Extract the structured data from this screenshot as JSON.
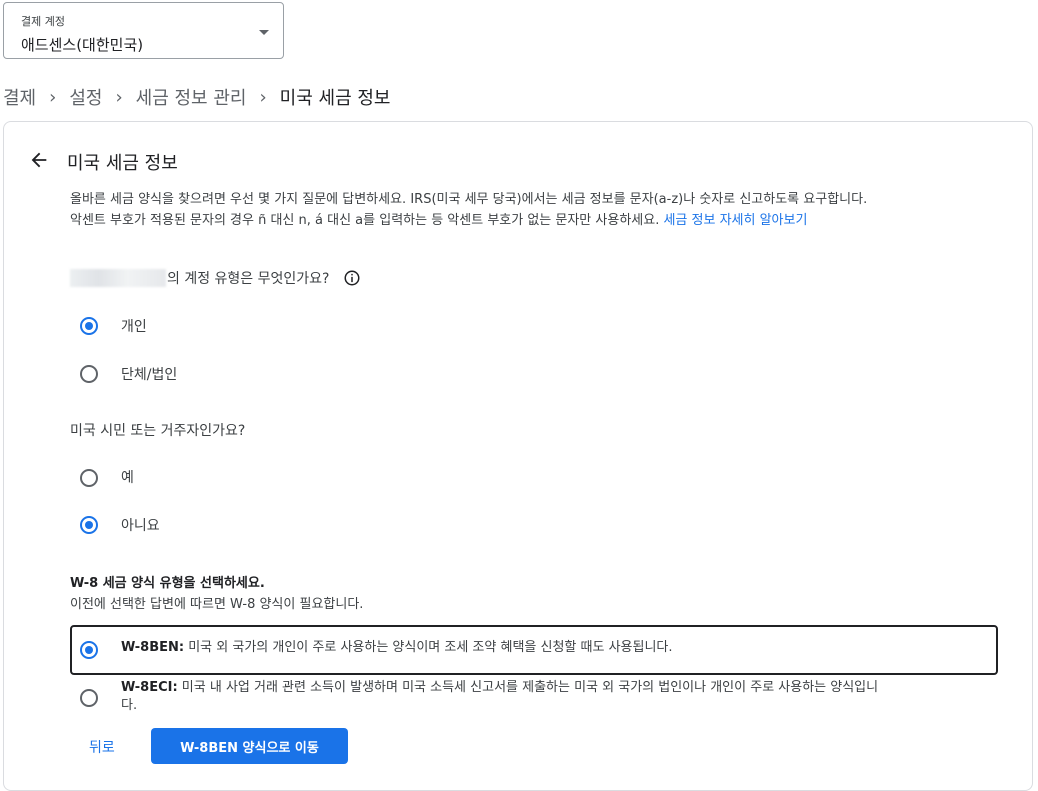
{
  "account_select": {
    "label": "결제 계정",
    "value": "애드센스(대한민국)"
  },
  "breadcrumb": {
    "items": [
      "결제",
      "설정",
      "세금 정보 관리"
    ],
    "current": "미국 세금 정보"
  },
  "card": {
    "title": "미국 세금 정보",
    "intro_line1": "올바른 세금 양식을 찾으려면 우선 몇 가지 질문에 답변하세요. IRS(미국 세무 당국)에서는 세금 정보를 문자(a-z)나 숫자로 신고하도록 요구합니다.",
    "intro_line2": "악센트 부호가 적용된 문자의 경우 ñ 대신 n, á 대신 a를 입력하는 등 악센트 부호가 없는 문자만 사용하세요.",
    "intro_link": "세금 정보 자세히 알아보기"
  },
  "question1": {
    "text": "의 계정 유형은 무엇인가요?",
    "options": [
      {
        "label": "개인",
        "selected": true
      },
      {
        "label": "단체/법인",
        "selected": false
      }
    ]
  },
  "question2": {
    "text": "미국 시민 또는 거주자인가요?",
    "options": [
      {
        "label": "예",
        "selected": false
      },
      {
        "label": "아니요",
        "selected": true
      }
    ]
  },
  "w8": {
    "title": "W-8 세금 양식 유형을 선택하세요.",
    "subtitle": "이전에 선택한 답변에 따르면 W-8 양식이 필요합니다.",
    "options": [
      {
        "code": "W-8BEN:",
        "desc": "미국 외 국가의 개인이 주로 사용하는 양식이며 조세 조약 혜택을 신청할 때도 사용됩니다.",
        "selected": true
      },
      {
        "code": "W-8ECI:",
        "desc": "미국 내 사업 거래 관련 소득이 발생하며 미국 소득세 신고서를 제출하는 미국 외 국가의 법인이나 개인이 주로 사용하는 양식입니",
        "desc_wrap": "다.",
        "selected": false
      }
    ]
  },
  "actions": {
    "back": "뒤로",
    "primary": "W-8BEN 양식으로 이동"
  },
  "colors": {
    "accent": "#1a73e8",
    "text": "#202124",
    "muted": "#5f6368"
  },
  "icons": [
    "chevron-down-icon",
    "chevron-right-icon",
    "arrow-back-icon",
    "info-icon"
  ]
}
